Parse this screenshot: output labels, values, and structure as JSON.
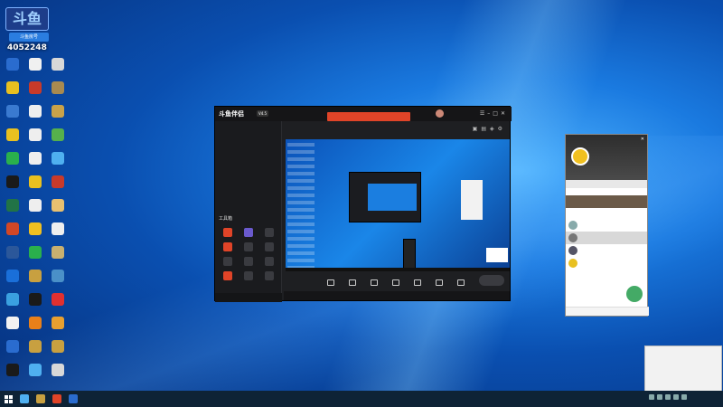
{
  "desktop": {
    "logo_text": "斗鱼",
    "badge_text": "斗鱼房号",
    "room_number": "4052248",
    "icons": [
      {
        "label": "",
        "color": "#2a6ccf"
      },
      {
        "label": "",
        "color": "#f0f0f0"
      },
      {
        "label": "",
        "color": "#d8d8d8"
      },
      {
        "label": "",
        "color": "#e8c020"
      },
      {
        "label": "",
        "color": "#c83a2a"
      },
      {
        "label": "",
        "color": "#a88a50"
      },
      {
        "label": "",
        "color": "#3a7ad0"
      },
      {
        "label": "",
        "color": "#eeeeee"
      },
      {
        "label": "",
        "color": "#c9a24a"
      },
      {
        "label": "",
        "color": "#e8c020"
      },
      {
        "label": "",
        "color": "#eeeeee"
      },
      {
        "label": "",
        "color": "#56b04c"
      },
      {
        "label": "",
        "color": "#2ab04c"
      },
      {
        "label": "",
        "color": "#eeeeee"
      },
      {
        "label": "",
        "color": "#4fb0f0"
      },
      {
        "label": "",
        "color": "#1a1a1a"
      },
      {
        "label": "",
        "color": "#e8c020"
      },
      {
        "label": "",
        "color": "#c83a2a"
      },
      {
        "label": "",
        "color": "#217346"
      },
      {
        "label": "",
        "color": "#eeeeee"
      },
      {
        "label": "",
        "color": "#e8c070"
      },
      {
        "label": "",
        "color": "#d24726"
      },
      {
        "label": "",
        "color": "#f0c020"
      },
      {
        "label": "",
        "color": "#eeeeee"
      },
      {
        "label": "",
        "color": "#2b579a"
      },
      {
        "label": "",
        "color": "#2ab04c"
      },
      {
        "label": "",
        "color": "#c8b070"
      },
      {
        "label": "",
        "color": "#1a6fd9"
      },
      {
        "label": "",
        "color": "#c8a040"
      },
      {
        "label": "",
        "color": "#4a90c8"
      },
      {
        "label": "",
        "color": "#3aa0e0"
      },
      {
        "label": "",
        "color": "#1a1a1a"
      },
      {
        "label": "",
        "color": "#e03030"
      },
      {
        "label": "",
        "color": "#f2f2f2"
      },
      {
        "label": "",
        "color": "#e8801a"
      },
      {
        "label": "",
        "color": "#e8a030"
      },
      {
        "label": "",
        "color": "#2a6ccf"
      },
      {
        "label": "",
        "color": "#c8a040"
      },
      {
        "label": "",
        "color": "#c8a040"
      },
      {
        "label": "",
        "color": "#1a1a1a"
      },
      {
        "label": "",
        "color": "#4fb0f0"
      },
      {
        "label": "",
        "color": "#d8d8d8"
      }
    ]
  },
  "app": {
    "logo": "斗鱼伴侣",
    "version": "V4.5",
    "notice": "",
    "side_tabs": [
      "",
      "",
      ""
    ],
    "side_items": [
      "",
      ""
    ],
    "tools_title": "工具箱",
    "tools": [
      {
        "label": "",
        "color": "#e04428"
      },
      {
        "label": "",
        "color": "#6a5acd"
      },
      {
        "label": "",
        "color": "#3a3b40"
      },
      {
        "label": "",
        "color": "#e04428"
      },
      {
        "label": "",
        "color": "#3a3b40"
      },
      {
        "label": "",
        "color": "#3a3b40"
      },
      {
        "label": "",
        "color": "#3a3b40"
      },
      {
        "label": "",
        "color": "#3a3b40"
      },
      {
        "label": "",
        "color": "#3a3b40"
      },
      {
        "label": "",
        "color": "#e04428"
      },
      {
        "label": "",
        "color": "#3a3b40"
      },
      {
        "label": "",
        "color": "#3a3b40"
      }
    ],
    "side_bottom": "",
    "room_title": "",
    "room_tag": "",
    "toolbar": [
      "",
      "",
      "",
      "",
      "",
      "",
      ""
    ],
    "live_button": "",
    "bottom_text": ""
  },
  "qq": {
    "name": "",
    "signature": "",
    "search_placeholder": "",
    "tabs": [
      "",
      "",
      "",
      "",
      ""
    ],
    "banner": "",
    "groups": [
      "",
      "",
      ""
    ],
    "contacts": [
      {
        "name": "",
        "color": "#8aa"
      },
      {
        "name": "",
        "color": "#777"
      },
      {
        "name": "",
        "color": "#556"
      },
      {
        "name": "",
        "color": "#e8c020"
      }
    ],
    "footer": ""
  },
  "toast": {
    "app": "",
    "title": "",
    "body": "",
    "button": ""
  },
  "taskbar": {
    "time": "",
    "date": ""
  }
}
